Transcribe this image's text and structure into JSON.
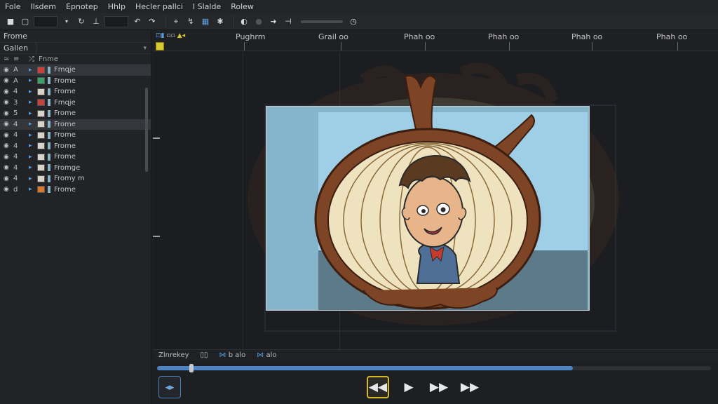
{
  "menu": [
    "Fole",
    "Ilsdem",
    "Epnotep",
    "Hhlp",
    "Hecler pallci",
    "I Slalde",
    "Rolew"
  ],
  "toolbar": {
    "icons": [
      "new-file-icon",
      "window-icon",
      "dropdown-icon",
      "transform-icon",
      "align-icon",
      "field",
      "undo-icon",
      "select-tool-icon",
      "lasso-tool-icon",
      "grid-tool-icon",
      "magic-tool-icon",
      "brush-icon",
      "color-icon",
      "arrow-icon",
      "playhead-icon",
      "clock-icon"
    ]
  },
  "left_panel": {
    "title": "Frome",
    "filter_label": "Gallen",
    "header_label": "Fnme",
    "layers": [
      {
        "num": "A",
        "name": "Fmqje",
        "selected": true,
        "thumb": "#c7423a"
      },
      {
        "num": "A",
        "name": "Frome",
        "selected": false,
        "thumb": "#3aa06a"
      },
      {
        "num": "4",
        "name": "Frome",
        "selected": false,
        "thumb": "#d8d4c8"
      },
      {
        "num": "3",
        "name": "Fmqje",
        "selected": false,
        "thumb": "#c7423a"
      },
      {
        "num": "5",
        "name": "Frome",
        "selected": false,
        "thumb": "#d8d4c8"
      },
      {
        "num": "4",
        "name": "Frome",
        "selected": true,
        "thumb": "#d8d4c8"
      },
      {
        "num": "4",
        "name": "Frome",
        "selected": false,
        "thumb": "#d8d4c8"
      },
      {
        "num": "4",
        "name": "Frome",
        "selected": false,
        "thumb": "#d8d4c8"
      },
      {
        "num": "4",
        "name": "Frome",
        "selected": false,
        "thumb": "#d8d4c8"
      },
      {
        "num": "4",
        "name": "Fromge",
        "selected": false,
        "thumb": "#d8d4c8"
      },
      {
        "num": "4",
        "name": "Fromy m",
        "selected": false,
        "thumb": "#d8d4c8"
      },
      {
        "num": "d",
        "name": "Frome",
        "selected": false,
        "thumb": "#d87a2a"
      }
    ]
  },
  "ruler": {
    "labels": [
      "Pughrm",
      "Grail oo",
      "Phah oo",
      "Phah oo",
      "Phah oo",
      "Phah oo"
    ]
  },
  "bottom": {
    "tabs": [
      "Zlnrekey",
      "▯▯",
      "b alo",
      "alo"
    ]
  },
  "scrubber": {
    "progress": 0.75
  },
  "colors": {
    "accent": "#4a9fe6",
    "playhead": "#d6c832",
    "rewind_border": "#d4b825"
  }
}
